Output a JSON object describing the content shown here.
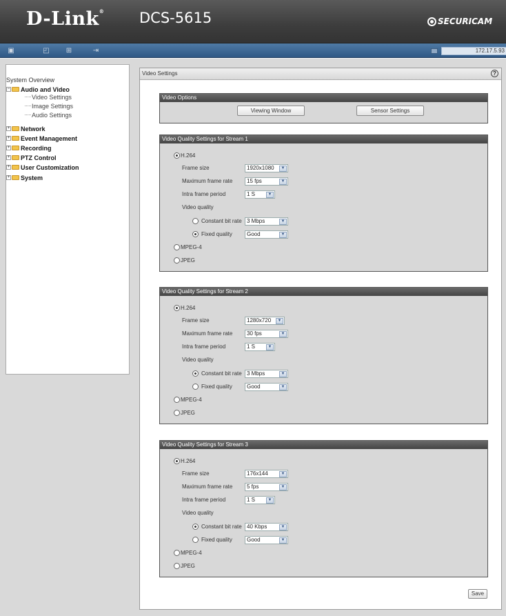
{
  "header": {
    "logo": "D-Link",
    "model": "DCS-5615",
    "brand": "SECURICAM"
  },
  "toolbar": {
    "ip": "172.17.5.93",
    "icons": [
      "snapshot-icon",
      "camera-view-icon",
      "settings-icon",
      "logout-icon"
    ]
  },
  "sidebar": {
    "overview": "System Overview",
    "audio_video": "Audio and Video",
    "sub_items": [
      "Video Settings",
      "Image Settings",
      "Audio Settings"
    ],
    "groups": [
      "Network",
      "Event Management",
      "Recording",
      "PTZ Control",
      "User Customization",
      "System"
    ]
  },
  "main": {
    "title": "Video Settings",
    "help": "?",
    "save": "Save"
  },
  "options": {
    "title": "Video Options",
    "viewing_window": "Viewing Window",
    "sensor_settings": "Sensor Settings"
  },
  "labels": {
    "h264": "H.264",
    "frame_size": "Frame size",
    "max_frame_rate": "Maximum frame rate",
    "intra_frame": "Intra frame period",
    "video_quality": "Video quality",
    "cbr": "Constant bit rate",
    "fixed": "Fixed quality",
    "mpeg4": "MPEG-4",
    "jpeg": "JPEG"
  },
  "streams": [
    {
      "title": "Video Quality Settings for Stream 1",
      "frame_size": "1920x1080",
      "frame_rate": "15 fps",
      "intra": "1 S",
      "bitrate": "3 Mbps",
      "quality": "Good",
      "cbr_selected": false
    },
    {
      "title": "Video Quality Settings for Stream 2",
      "frame_size": "1280x720",
      "frame_rate": "30 fps",
      "intra": "1 S",
      "bitrate": "3 Mbps",
      "quality": "Good",
      "cbr_selected": true
    },
    {
      "title": "Video Quality Settings for Stream 3",
      "frame_size": "176x144",
      "frame_rate": "5 fps",
      "intra": "1 S",
      "bitrate": "40 Kbps",
      "quality": "Good",
      "cbr_selected": true
    }
  ]
}
